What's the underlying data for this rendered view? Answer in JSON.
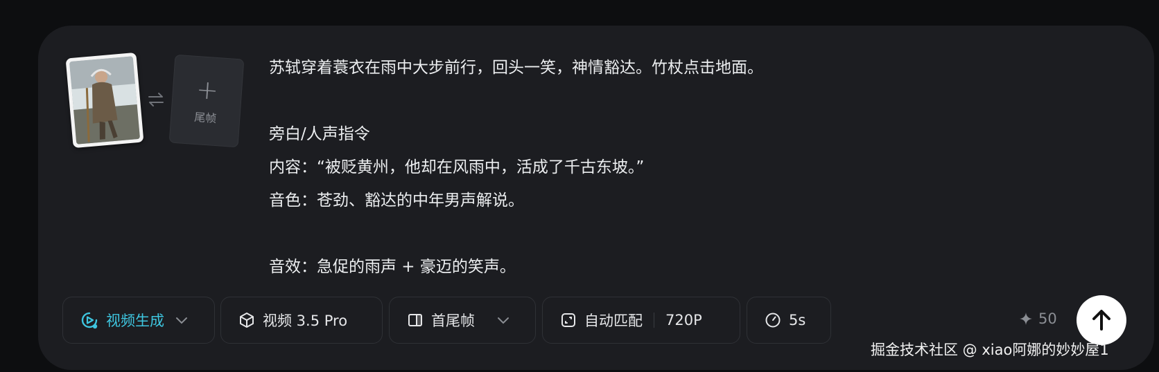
{
  "frames": {
    "first_frame_alt": "首帧",
    "last_frame_label": "尾帧",
    "last_frame_plus": "+"
  },
  "prompt": {
    "lines": [
      "苏轼穿着蓑衣在雨中大步前行，回头一笑，神情豁达。竹杖点击地面。",
      "",
      "旁白/人声指令",
      "内容：“被贬黄州，他却在风雨中，活成了千古东坡。”",
      "音色：苍劲、豁达的中年男声解说。",
      "",
      "音效：急促的雨声 + 豪迈的笑声。"
    ]
  },
  "toolbar": {
    "mode_label": "视频生成",
    "model_label": "视频 3.5 Pro",
    "frame_mode_label": "首尾帧",
    "ratio_label": "自动匹配",
    "resolution_label": "720P",
    "duration_label": "5s",
    "credits": "50"
  },
  "colors": {
    "accent": "#3ec6e0",
    "card_bg": "#1c1d21",
    "page_bg": "#0d0e10"
  },
  "watermark": "掘金技术社区 @ xiao阿娜的妙妙屋1"
}
